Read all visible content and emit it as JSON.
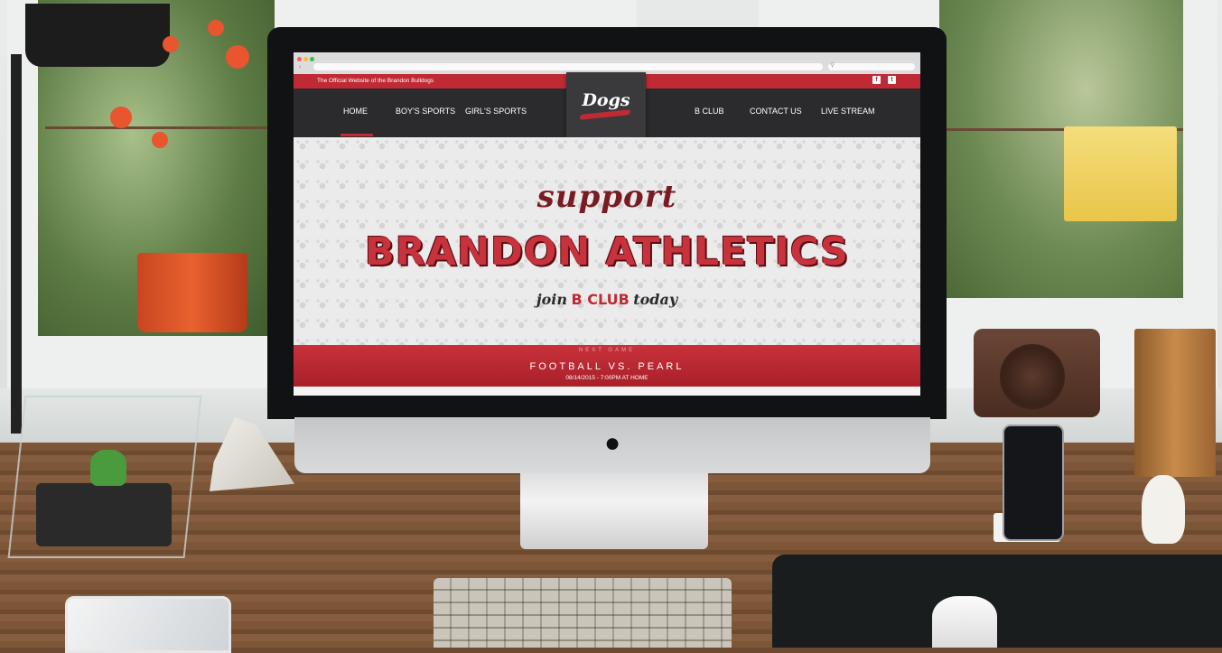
{
  "site": {
    "tagline": "The Official Website of the Brandon Bulldogs",
    "logo_text": "Dogs",
    "social": [
      {
        "icon": "facebook-icon",
        "glyph": "f"
      },
      {
        "icon": "twitter-icon",
        "glyph": "t"
      }
    ],
    "nav_left": [
      "HOME",
      "BOY'S SPORTS",
      "GIRL'S SPORTS"
    ],
    "nav_right": [
      "B CLUB",
      "CONTACT US",
      "LIVE STREAM"
    ],
    "active_nav": "HOME",
    "hero": {
      "script_line": "support",
      "headline": "BRANDON ATHLETICS",
      "join_prefix": "join",
      "join_club": "B CLUB",
      "join_suffix": "today"
    },
    "next_game": {
      "label": "NEXT GAME",
      "title": "FOOTBALL VS. PEARL",
      "datetime": "08/14/2015 - 7:00PM AT HOME"
    },
    "colors": {
      "brand_red": "#bf2a35",
      "nav_dark": "#2b2b2d",
      "dark_red": "#7a1a22"
    }
  },
  "device": {
    "logo_icon": "apple-logo-icon"
  }
}
